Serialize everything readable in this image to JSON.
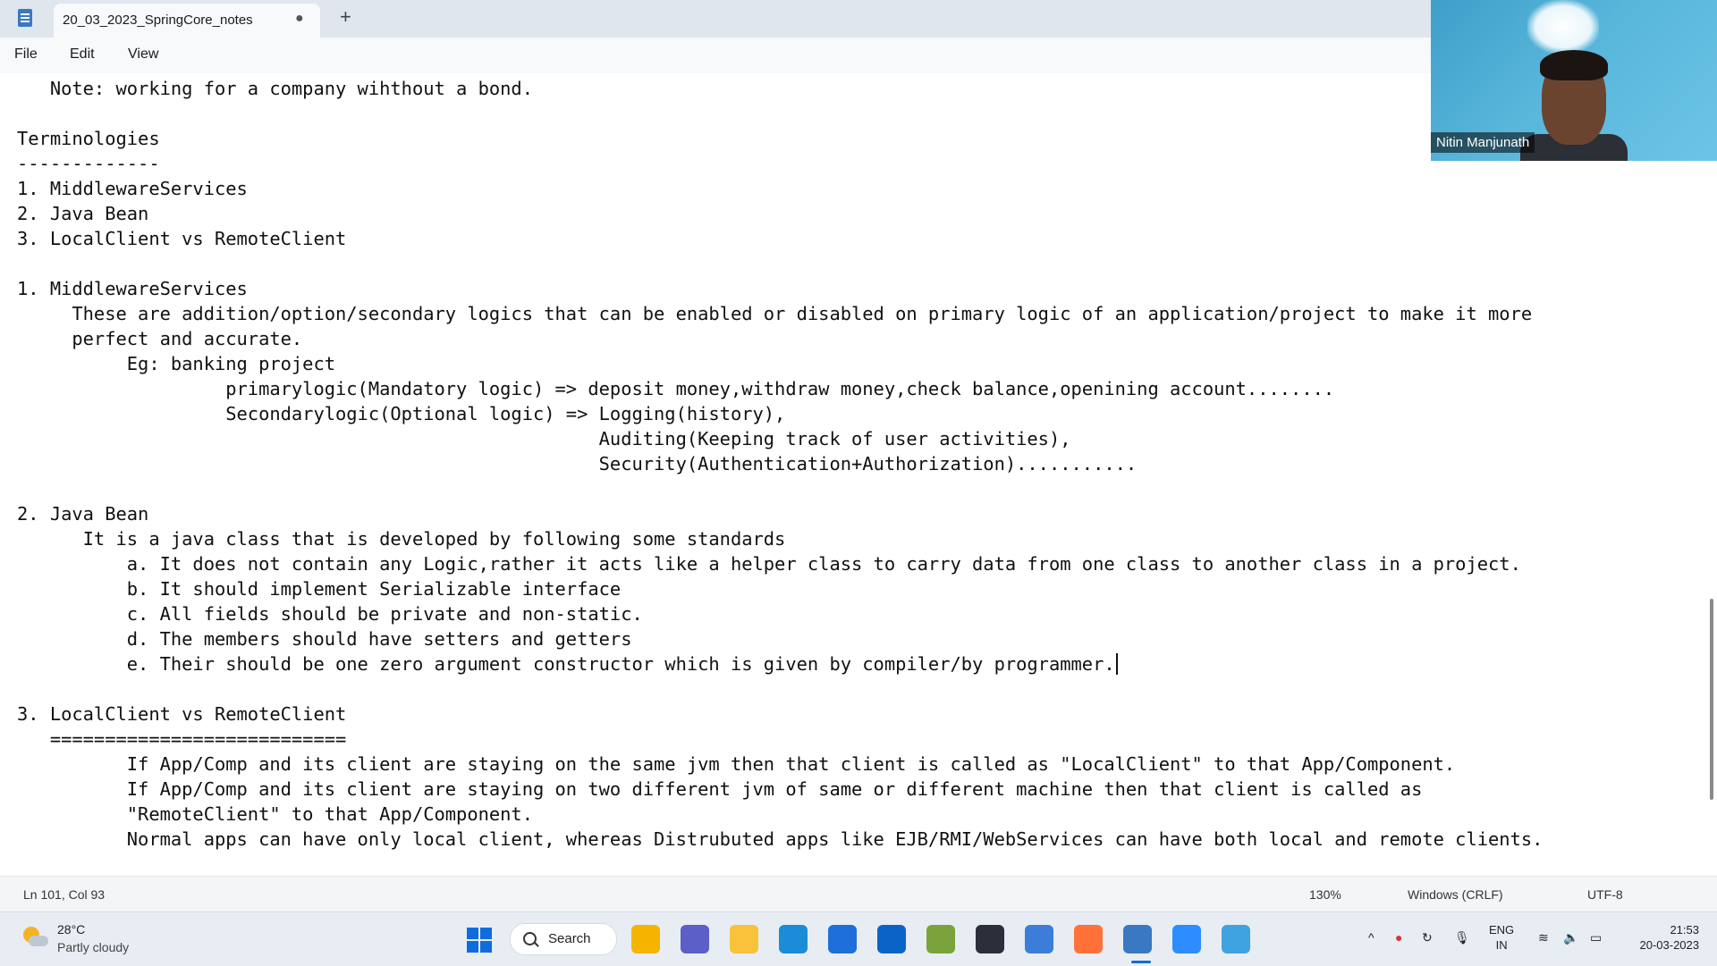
{
  "window": {
    "tab_title": "20_03_2023_SpringCore_notes",
    "tab_unsaved_indicator": "●",
    "new_tab_label": "+"
  },
  "menu": {
    "file": "File",
    "edit": "Edit",
    "view": "View"
  },
  "editor": {
    "lines": [
      "   Note: working for a company wihthout a bond.",
      "",
      "Terminologies",
      "-------------",
      "1. MiddlewareServices",
      "2. Java Bean",
      "3. LocalClient vs RemoteClient",
      "",
      "1. MiddlewareServices",
      "     These are addition/option/secondary logics that can be enabled or disabled on primary logic of an application/project to make it more",
      "     perfect and accurate.",
      "          Eg: banking project",
      "                   primarylogic(Mandatory logic) => deposit money,withdraw money,check balance,openining account........",
      "                   Secondarylogic(Optional logic) => Logging(history),",
      "                                                     Auditing(Keeping track of user activities),",
      "                                                     Security(Authentication+Authorization)...........",
      "",
      "2. Java Bean",
      "      It is a java class that is developed by following some standards",
      "          a. It does not contain any Logic,rather it acts like a helper class to carry data from one class to another class in a project.",
      "          b. It should implement Serializable interface",
      "          c. All fields should be private and non-static.",
      "          d. The members should have setters and getters",
      "          e. Their should be one zero argument constructor which is given by compiler/by programmer.",
      "",
      "3. LocalClient vs RemoteClient",
      "   ===========================",
      "          If App/Comp and its client are staying on the same jvm then that client is called as \"LocalClient\" to that App/Component.",
      "          If App/Comp and its client are staying on two different jvm of same or different machine then that client is called as",
      "          \"RemoteClient\" to that App/Component.",
      "          Normal apps can have only local client, whereas Distrubuted apps like EJB/RMI/WebServices can have both local and remote clients."
    ],
    "caret_line_index": 23
  },
  "video": {
    "participant_name": "Nitin Manjunath"
  },
  "status": {
    "position": "Ln 101, Col 93",
    "zoom": "130%",
    "line_ending": "Windows (CRLF)",
    "encoding": "UTF-8"
  },
  "taskbar": {
    "weather_temp": "28°C",
    "weather_desc": "Partly cloudy",
    "search_label": "Search",
    "lang_line1": "ENG",
    "lang_line2": "IN",
    "time": "21:53",
    "date": "20-03-2023",
    "icons": [
      {
        "name": "file-explorer-icon",
        "color": "#f4b400"
      },
      {
        "name": "teams-chat-icon",
        "color": "#5b5fc7"
      },
      {
        "name": "folder-icon",
        "color": "#f8c33a"
      },
      {
        "name": "edge-icon",
        "color": "#1b8cd8"
      },
      {
        "name": "store-icon",
        "color": "#1e6fd9"
      },
      {
        "name": "mail-icon",
        "color": "#0a64c8"
      },
      {
        "name": "app-icon",
        "color": "#7aa33b"
      },
      {
        "name": "app-icon",
        "color": "#2a2f3a"
      },
      {
        "name": "app-icon",
        "color": "#3b7dd8"
      },
      {
        "name": "firefox-icon",
        "color": "#ff7139"
      },
      {
        "name": "notepad-icon",
        "color": "#3a78c2"
      },
      {
        "name": "zoom-icon",
        "color": "#2d8cff"
      },
      {
        "name": "app-icon",
        "color": "#3fa3e0"
      }
    ]
  }
}
